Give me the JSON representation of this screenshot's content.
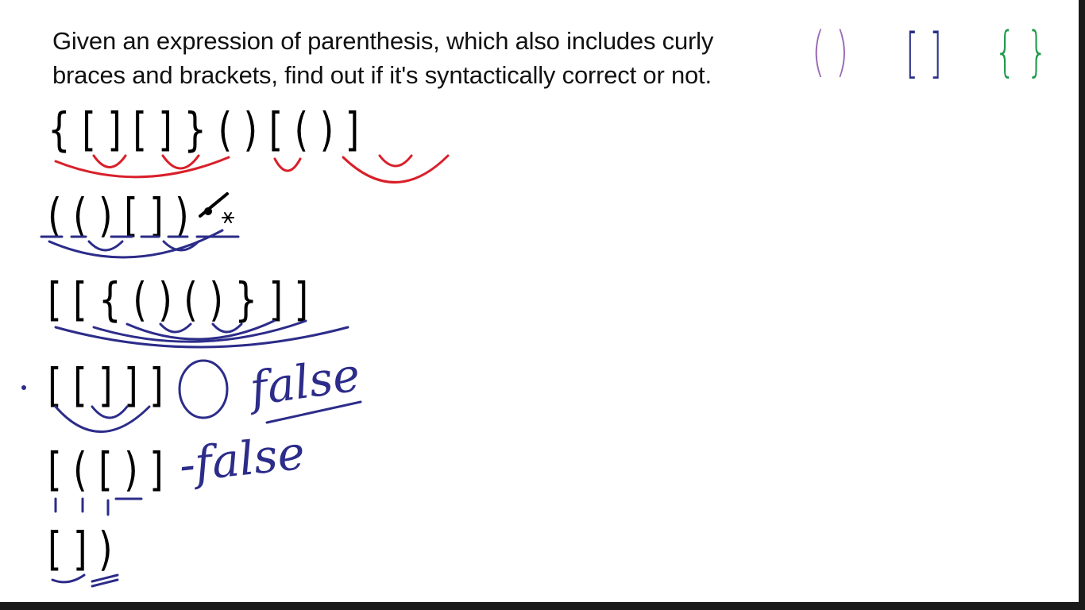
{
  "prompt": {
    "line1": "Given an expression of parenthesis, which also includes curly",
    "line2": "braces and brackets, find out if it's syntactically correct or not."
  },
  "legend": {
    "parens": "( )",
    "brackets": "[ ]",
    "braces": "{ }",
    "parens_color": "#9b6bb5",
    "brackets_color": "#2c2f8a",
    "braces_color": "#1f9a4a"
  },
  "expressions": [
    {
      "text": "{ [ ] [ ] } ( ) [ ( ) ]",
      "annotation": ""
    },
    {
      "text": "( ( ) [ ] )",
      "annotation": ""
    },
    {
      "text": "[ [ { ( ) ( ) } ] ]",
      "annotation": ""
    },
    {
      "text": "[ [ ] ] ]",
      "annotation": "false"
    },
    {
      "text": "[ ( [ ) ]",
      "annotation": "-false"
    },
    {
      "text": "[ ] )",
      "annotation": ""
    }
  ],
  "colors": {
    "red_ink": "#d8202a",
    "blue_ink": "#2c2c8a"
  }
}
